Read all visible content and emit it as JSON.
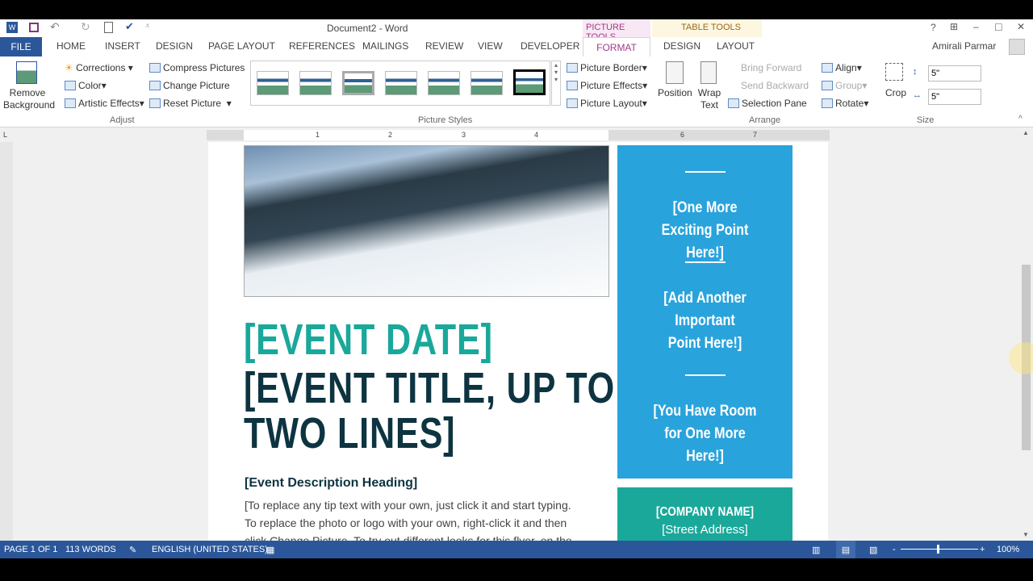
{
  "title": "Document2 - Word",
  "quick_access": [
    "word-icon",
    "save-icon",
    "undo-icon",
    "redo-icon",
    "print-preview-icon",
    "spelling-icon",
    "customize-icon"
  ],
  "context": {
    "picture_tools": "PICTURE TOOLS",
    "table_tools": "TABLE TOOLS"
  },
  "tabs": [
    "FILE",
    "HOME",
    "INSERT",
    "DESIGN",
    "PAGE LAYOUT",
    "REFERENCES",
    "MAILINGS",
    "REVIEW",
    "VIEW",
    "DEVELOPER",
    "FORMAT",
    "DESIGN",
    "LAYOUT"
  ],
  "active_tab": "FORMAT",
  "user": "Amirali Parmar",
  "window_controls": {
    "help": "?",
    "restore_ribbon": "⊞",
    "min": "–",
    "max": "□",
    "close": "✕"
  },
  "ribbon": {
    "remove_bg": "Remove Background",
    "corrections": "Corrections",
    "color": "Color",
    "artistic": "Artistic Effects",
    "compress": "Compress Pictures",
    "change": "Change Picture",
    "reset": "Reset Picture",
    "adjust": "Adjust",
    "picture_styles": "Picture Styles",
    "border": "Picture Border",
    "effects": "Picture Effects",
    "layout": "Picture Layout",
    "position": "Position",
    "wrap": "Wrap Text",
    "bring_forward": "Bring Forward",
    "send_backward": "Send Backward",
    "selection_pane": "Selection Pane",
    "align": "Align",
    "group": "Group",
    "rotate": "Rotate",
    "arrange": "Arrange",
    "crop": "Crop",
    "height": "5\"",
    "width": "5\"",
    "size": "Size"
  },
  "ruler": [
    "1",
    "2",
    "3",
    "4",
    "6",
    "7"
  ],
  "doc": {
    "event_date": "[EVENT DATE]",
    "title_line1": "[EVENT TITLE, UP TO",
    "title_line2": "TWO LINES]",
    "desc_heading": "[Event Description Heading]",
    "body": [
      "[To replace any tip text with your own, just click it and start typing.",
      "To replace the photo or logo with your own, right-click it and then",
      "click Change Picture. To try out different looks for this flyer, on the"
    ],
    "points": [
      "[One More Exciting Point Here!]",
      "[Add Another Important Point Here!]",
      "[You Have Room for One More Here!]"
    ],
    "company": "[COMPANY NAME]",
    "street": "[Street Address]"
  },
  "colors": {
    "accent": "#2b579a",
    "teal": "#1aa89a",
    "blue_panel": "#29a3dc",
    "title_dark": "#0d3440"
  },
  "status": {
    "page": "PAGE 1 OF 1",
    "words": "113 WORDS",
    "language": "ENGLISH (UNITED STATES)",
    "zoom": "100%",
    "zoom_level": 100
  }
}
